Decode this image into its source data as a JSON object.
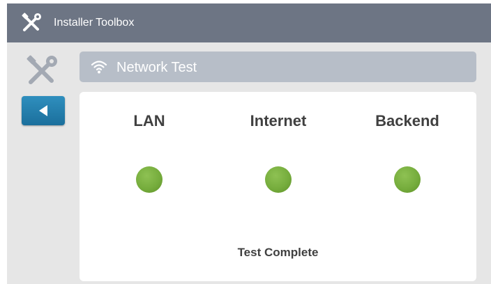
{
  "app": {
    "title": "Installer Toolbox",
    "icon": "tools-icon"
  },
  "sidebar": {
    "tools_icon": "tools-icon",
    "back_button_icon": "back-arrow-icon"
  },
  "section": {
    "icon": "wifi-icon",
    "title": "Network Test"
  },
  "tests": [
    {
      "label": "LAN",
      "status": "ok",
      "status_color": "#76ad3d"
    },
    {
      "label": "Internet",
      "status": "ok",
      "status_color": "#76ad3d"
    },
    {
      "label": "Backend",
      "status": "ok",
      "status_color": "#76ad3d"
    }
  ],
  "status_message": "Test Complete",
  "colors": {
    "title_bar": "#6d7584",
    "background": "#e6e6e6",
    "header_bar": "#b7bec8",
    "accent_blue": "#1f7aa8",
    "success_green": "#76ad3d"
  }
}
